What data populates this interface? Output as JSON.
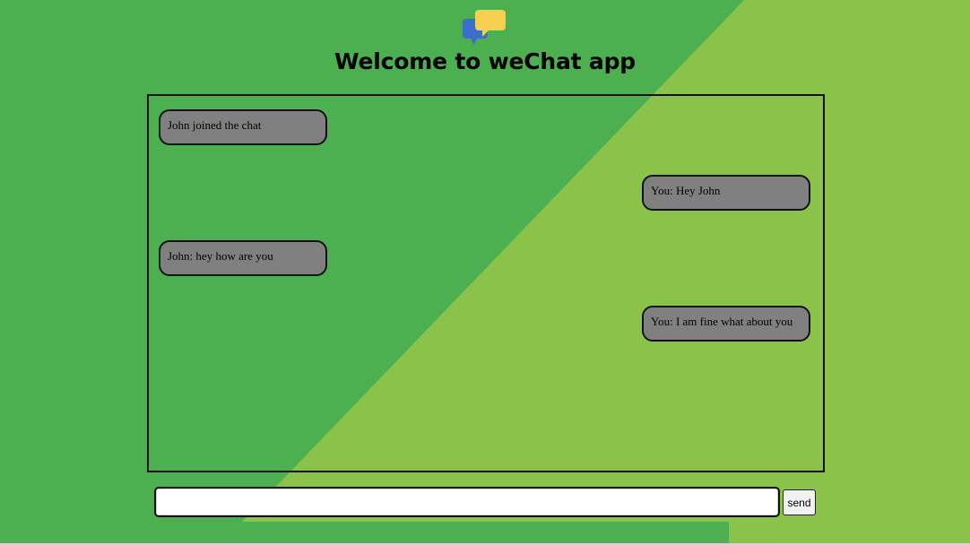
{
  "app": {
    "title": "Welcome to weChat app",
    "logo_icon": "chat-bubbles-icon"
  },
  "colors": {
    "background_dark": "#4caf50",
    "background_light": "#8bc34a",
    "bubble": "#808080",
    "logo_blue": "#3b6fc9",
    "logo_yellow": "#f6cf4e"
  },
  "messages": [
    {
      "side": "left",
      "text": "John joined the chat"
    },
    {
      "side": "right",
      "text": "You: Hey John"
    },
    {
      "side": "left",
      "text": "John: hey how are you"
    },
    {
      "side": "right",
      "text": "You: I am fine what about you"
    }
  ],
  "composer": {
    "input_value": "",
    "placeholder": "",
    "send_label": "send"
  }
}
